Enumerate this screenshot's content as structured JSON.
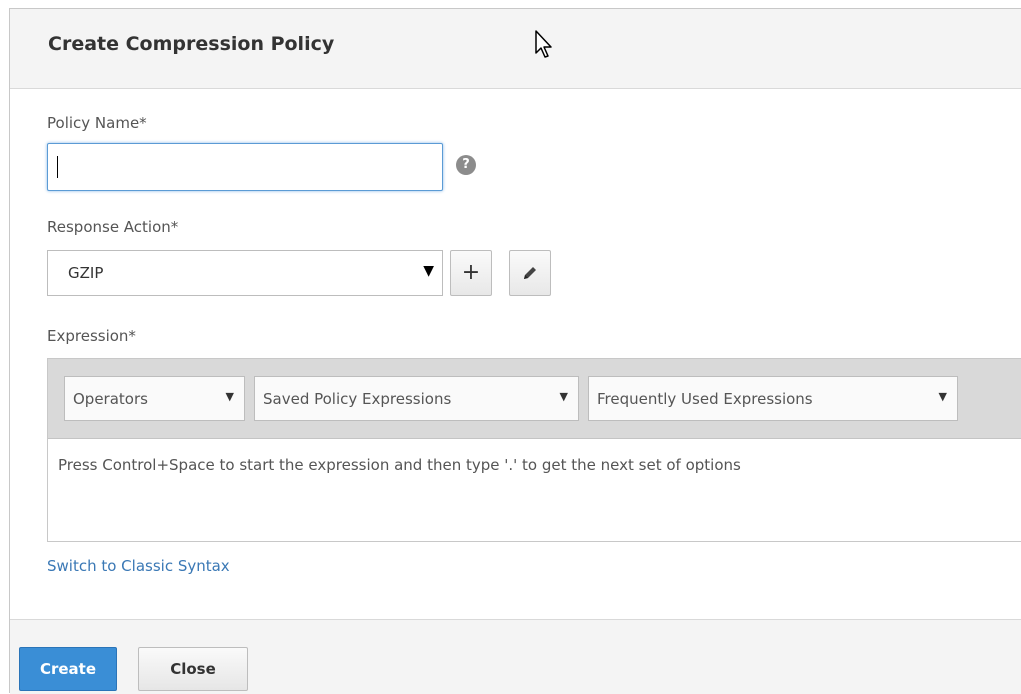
{
  "dialog": {
    "title": "Create Compression Policy"
  },
  "form": {
    "policy_name": {
      "label": "Policy Name*",
      "value": "",
      "help_icon": "?"
    },
    "response_action": {
      "label": "Response Action*",
      "selected": "GZIP",
      "add_icon": "+",
      "edit_icon": "pencil-icon"
    },
    "expression": {
      "label": "Expression*",
      "toolbar": [
        {
          "label": "Operators"
        },
        {
          "label": "Saved Policy Expressions"
        },
        {
          "label": "Frequently Used Expressions"
        }
      ],
      "hint": "Press Control+Space to start the expression and then type '.' to get the next set of options"
    },
    "switch_link": "Switch to Classic Syntax"
  },
  "footer": {
    "create_label": "Create",
    "close_label": "Close"
  },
  "colors": {
    "primary": "#3a8ed6",
    "link": "#3a78b5",
    "focus_border": "#5b9bd5"
  }
}
